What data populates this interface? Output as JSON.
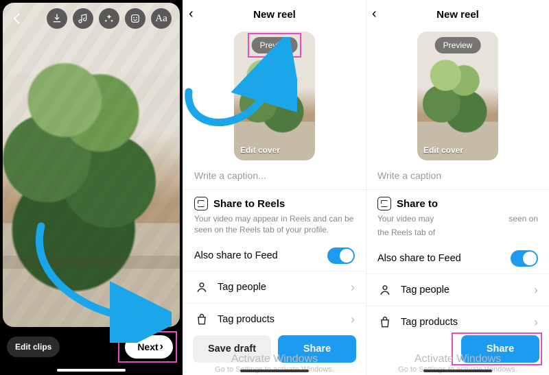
{
  "editor": {
    "edit_clips_label": "Edit clips",
    "next_label": "Next"
  },
  "new_reel": {
    "title": "New reel",
    "preview_label": "Preview",
    "edit_cover_label": "Edit cover",
    "caption_placeholder_full": "Write a caption...",
    "caption_placeholder_trunc": "Write a caption",
    "share_section_title_full": "Share to Reels",
    "share_section_title_trunc": "Share to",
    "share_section_desc_full": "Your video may appear in Reels and can be seen on the Reels tab of your profile.",
    "share_section_desc_trunc_left": "Your video may",
    "share_section_desc_trunc_right": "seen on",
    "share_section_desc_trunc_bottom": "the Reels tab of",
    "also_share_label": "Also share to Feed",
    "tag_people_label": "Tag people",
    "tag_products_label": "Tag products",
    "save_draft_label": "Save draft",
    "share_label": "Share"
  },
  "watermark": {
    "line1": "Activate Windows",
    "line2": "Go to Settings to activate Windows."
  }
}
